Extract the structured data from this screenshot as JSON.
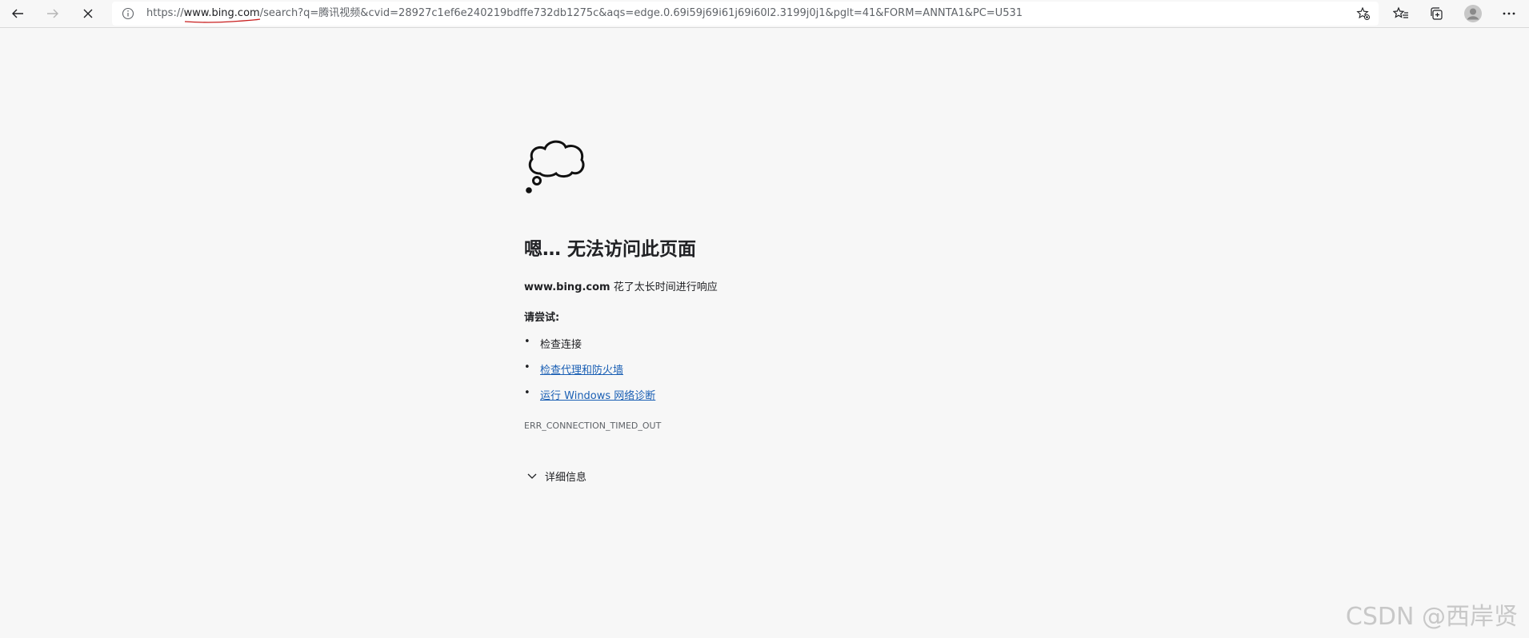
{
  "browser": {
    "url": {
      "scheme": "https://",
      "host": "www.bing.com",
      "path": "/search?q=腾讯视频&cvid=28927c1ef6e240219bdffe732db1275c&aqs=edge.0.69i59j69i61j69i60l2.3199j0j1&pglt=41&FORM=ANNTA1&PC=U531"
    },
    "icons": {
      "back": "back-arrow-icon",
      "forward": "forward-arrow-icon",
      "stop": "close-icon",
      "info": "info-icon",
      "add_favorite": "star-add-icon",
      "favorites": "favorites-icon",
      "collections": "collections-icon",
      "profile": "profile-avatar-icon",
      "more": "more-icon"
    }
  },
  "error_page": {
    "title": "嗯… 无法访问此页面",
    "host": "www.bing.com",
    "message": "花了太长时间进行响应",
    "try_label": "请尝试:",
    "suggestions": [
      "检查连接",
      "检查代理和防火墙",
      "运行 Windows 网络诊断"
    ],
    "bullet": "•",
    "error_code": "ERR_CONNECTION_TIMED_OUT",
    "details_label": "详细信息"
  },
  "watermark": "CSDN @西岸贤",
  "colors": {
    "background": "#f7f7f7",
    "link": "#1a5fb4",
    "annotation_underline": "#c81e1e"
  }
}
